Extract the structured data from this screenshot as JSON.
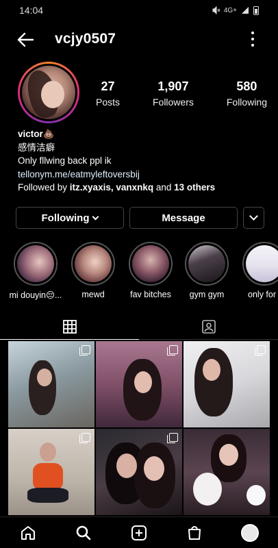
{
  "status": {
    "time": "14:04",
    "network": "4G+"
  },
  "profile": {
    "username": "vcjy0507",
    "stats": [
      {
        "value": "27",
        "label": "Posts"
      },
      {
        "value": "1,907",
        "label": "Followers"
      },
      {
        "value": "580",
        "label": "Following"
      }
    ],
    "name": "victor💩",
    "bio_line1": "感情洁癖",
    "bio_line2": "Only fllwing back ppl ik",
    "link": "tellonym.me/eatmyleftoversbij",
    "followed_by_prefix": "Followed by ",
    "followed_by_users": "itz.xyaxis, vanxnkq",
    "followed_by_mid": " and ",
    "followed_by_others": "13 others"
  },
  "actions": {
    "following_label": "Following",
    "message_label": "Message"
  },
  "highlights": [
    {
      "label": "mi douyin😔..."
    },
    {
      "label": "mewd"
    },
    {
      "label": "fav bitches"
    },
    {
      "label": "gym gym"
    },
    {
      "label": "only for f"
    }
  ],
  "tabs": [
    {
      "icon": "grid-icon"
    },
    {
      "icon": "tagged-icon"
    }
  ],
  "nav": [
    "home-icon",
    "search-icon",
    "add-post-icon",
    "shop-icon",
    "profile-avatar"
  ],
  "colors": {
    "background": "#000000",
    "ring_gradient": [
      "#f58529",
      "#dd2a7b",
      "#8134af"
    ]
  }
}
